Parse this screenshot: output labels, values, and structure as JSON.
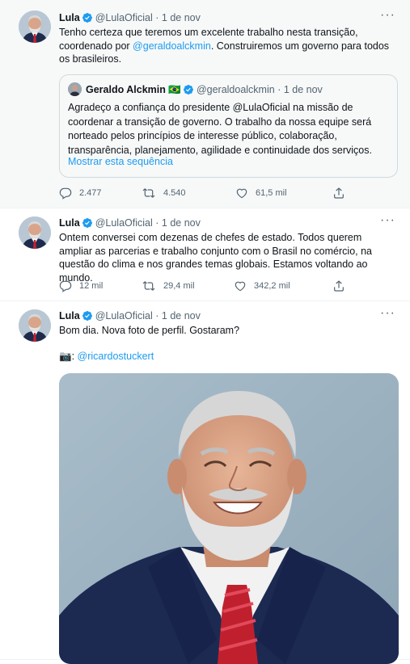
{
  "tweets": [
    {
      "name": "Lula",
      "handle": "@LulaOficial",
      "dot": "·",
      "date": "1 de nov",
      "text_pre": "Tenho certeza que teremos um excelente trabalho nesta transição, coordenado por ",
      "mention": "@geraldoalckmin",
      "text_post": ". Construiremos um governo para todos os brasileiros.",
      "quote": {
        "name": "Geraldo Alckmin",
        "flag": "🇧🇷",
        "handle": "@geraldoalckmin",
        "dot": "·",
        "date": "1 de nov",
        "text": "Agradeço a confiança do presidente @LulaOficial na missão de coordenar a transição de governo. O trabalho da nossa equipe será norteado pelos princípios de interesse público, colaboração, transparência, planejamento, agilidade e continuidade dos serviços.",
        "show_thread": "Mostrar esta sequência"
      },
      "replies": "2.477",
      "retweets": "4.540",
      "likes": "61,5 mil"
    },
    {
      "name": "Lula",
      "handle": "@LulaOficial",
      "dot": "·",
      "date": "1 de nov",
      "text": "Ontem conversei com dezenas de chefes de estado. Todos querem ampliar as parcerias e trabalho conjunto com o Brasil no comércio, na questão do clima e nos grandes temas globais. Estamos voltando ao mundo.",
      "replies": "12 mil",
      "retweets": "29,4 mil",
      "likes": "342,2 mil"
    },
    {
      "name": "Lula",
      "handle": "@LulaOficial",
      "dot": "·",
      "date": "1 de nov",
      "text": "Bom dia. Nova foto de perfil. Gostaram?",
      "camera": "📷",
      "credit_sep": ": ",
      "credit": "@ricardostuckert"
    }
  ],
  "icons": {
    "more": "more-icon",
    "verified": "verified-badge-icon",
    "reply": "reply-icon",
    "retweet": "retweet-icon",
    "like": "like-icon",
    "share": "share-icon"
  },
  "colors": {
    "accent": "#1d9bf0",
    "muted": "#536471",
    "border": "#cfd9de"
  }
}
